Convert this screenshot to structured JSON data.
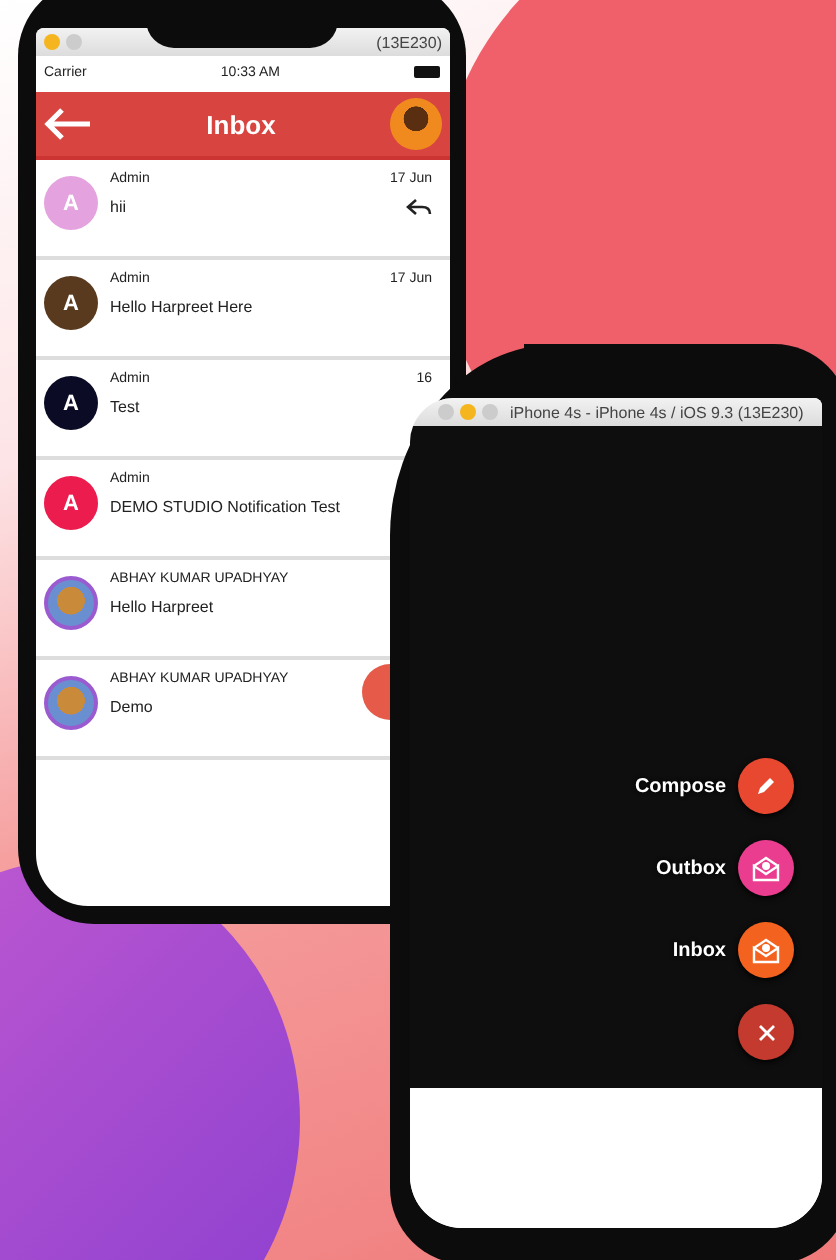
{
  "front_phone": {
    "simulator_bar": {
      "title": "(13E230)"
    },
    "status_bar": {
      "carrier": "Carrier",
      "time": "10:33 AM"
    },
    "header": {
      "title": "Inbox"
    },
    "messages": [
      {
        "kind": "letter",
        "initial": "A",
        "color": "#e4a2de",
        "sender": "Admin",
        "text": "hii",
        "date": "17 Jun",
        "replied": true
      },
      {
        "kind": "letter",
        "initial": "A",
        "color": "#5a3a1e",
        "sender": "Admin",
        "text": "Hello Harpreet Here",
        "date": "17 Jun",
        "replied": false
      },
      {
        "kind": "letter",
        "initial": "A",
        "color": "#0b0b26",
        "sender": "Admin",
        "text": "Test",
        "date": "16",
        "replied": false
      },
      {
        "kind": "letter",
        "initial": "A",
        "color": "#ec1c4e",
        "sender": "Admin",
        "text": "DEMO STUDIO Notification Test",
        "replied": false
      },
      {
        "kind": "photo",
        "sender": "ABHAY KUMAR UPADHYAY",
        "text": "Hello Harpreet",
        "replied": false
      },
      {
        "kind": "photo",
        "sender": "ABHAY KUMAR UPADHYAY",
        "text": "Demo",
        "replied": false
      }
    ]
  },
  "back_phone": {
    "simulator_bar": {
      "title": "iPhone 4s - iPhone 4s / iOS 9.3 (13E230)"
    },
    "fab_menu": [
      {
        "kind": "compose",
        "label": "Compose",
        "color": "#e8482f"
      },
      {
        "kind": "outbox",
        "label": "Outbox",
        "color": "#ea3d8f"
      },
      {
        "kind": "inbox",
        "label": "Inbox",
        "color": "#f4621f"
      },
      {
        "kind": "close",
        "color": "#c43a2e"
      }
    ]
  }
}
